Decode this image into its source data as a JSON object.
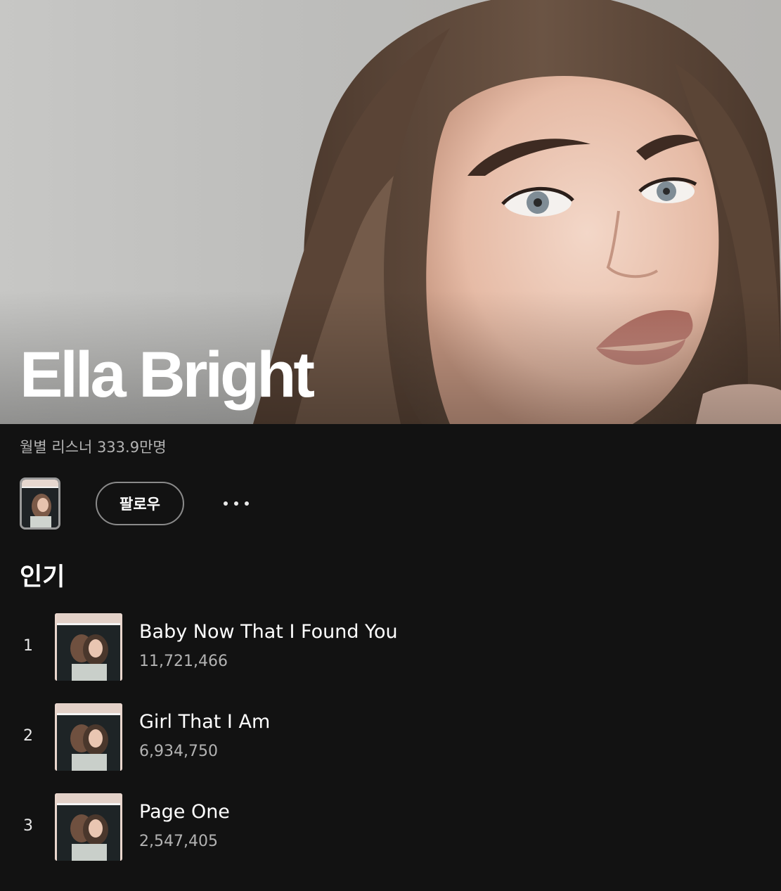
{
  "artist": {
    "name": "Ella Bright",
    "monthly_listeners": "월별 리스너 333.9만명"
  },
  "controls": {
    "follow_label": "팔로우",
    "more_icon": "more-horizontal-icon"
  },
  "popular": {
    "title": "인기",
    "tracks": [
      {
        "rank": "1",
        "title": "Baby Now That I Found You",
        "plays": "11,721,466"
      },
      {
        "rank": "2",
        "title": "Girl That I Am",
        "plays": "6,934,750"
      },
      {
        "rank": "3",
        "title": "Page One",
        "plays": "2,547,405"
      }
    ]
  },
  "colors": {
    "background": "#121212",
    "text_primary": "#ffffff",
    "text_secondary": "#b3b3b3"
  }
}
